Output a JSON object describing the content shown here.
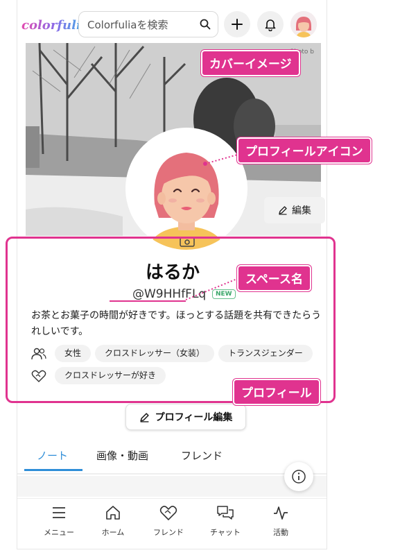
{
  "header": {
    "logo": "colorfulia",
    "search_placeholder": "Colorfuliaを検索"
  },
  "cover": {
    "photo_credit": "Photo b",
    "edit_label": "編集"
  },
  "profile": {
    "name": "はるか",
    "handle": "@W9HHfFLq",
    "new_badge": "NEW",
    "bio": "お茶とお菓子の時間が好きです。ほっとする話題を共有できたらうれしいです。",
    "identity_tags": [
      "女性",
      "クロスドレッサー（女装）",
      "トランスジェンダー"
    ],
    "interest_tags": [
      "クロスドレッサーが好き"
    ],
    "edit_label": "プロフィール編集"
  },
  "tabs": [
    {
      "label": "ノート"
    },
    {
      "label": "画像・動画"
    },
    {
      "label": "フレンド"
    }
  ],
  "bottom_nav": [
    {
      "label": "メニュー",
      "icon": "menu-icon"
    },
    {
      "label": "ホーム",
      "icon": "home-icon"
    },
    {
      "label": "フレンド",
      "icon": "friends-icon"
    },
    {
      "label": "チャット",
      "icon": "chat-icon"
    },
    {
      "label": "活動",
      "icon": "activity-icon"
    }
  ],
  "annotations": {
    "cover_image": "カバーイメージ",
    "profile_icon": "プロフィールアイコン",
    "space_name": "スペース名",
    "profile": "プロフィール"
  },
  "colors": {
    "accent": "#e0338f",
    "tab_active": "#2f8ed8",
    "new_badge": "#3aa769"
  }
}
